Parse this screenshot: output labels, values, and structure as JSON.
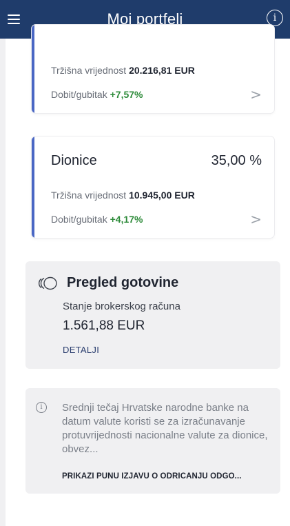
{
  "header": {
    "title": "Moj portfelj",
    "menu_icon": "hamburger-menu-icon",
    "info_icon": "info-icon"
  },
  "cards": [
    {
      "market_label": "Tržišna vrijednost",
      "market_value": "20.216,81 EUR",
      "profit_label": "Dobit/gubitak",
      "profit_value": "+7,57%",
      "chevron": ">"
    },
    {
      "name": "Dionice",
      "percent": "35,00 %",
      "market_label": "Tržišna vrijednost",
      "market_value": "10.945,00 EUR",
      "profit_label": "Dobit/gubitak",
      "profit_value": "+4,17%",
      "chevron": ">"
    }
  ],
  "cash": {
    "icon": "coins-icon",
    "title": "Pregled gotovine",
    "subtitle": "Stanje brokerskog računa",
    "amount": "1.561,88 EUR",
    "link": "DETALJI"
  },
  "disclaimer": {
    "icon": "info-icon",
    "text": "Srednji tečaj Hrvatske narodne banke na datum valute koristi se za izračunavanje protuvrijednosti nacionalne valute za dionice, obvez...",
    "link": "PRIKAŽI PUNU IZJAVU O ODRICANJU ODGO..."
  },
  "colors": {
    "header_bg": "#1f3c6b",
    "accent": "#4a67c4",
    "positive": "#2e8b3a",
    "panel_bg": "#f0f0f2"
  }
}
